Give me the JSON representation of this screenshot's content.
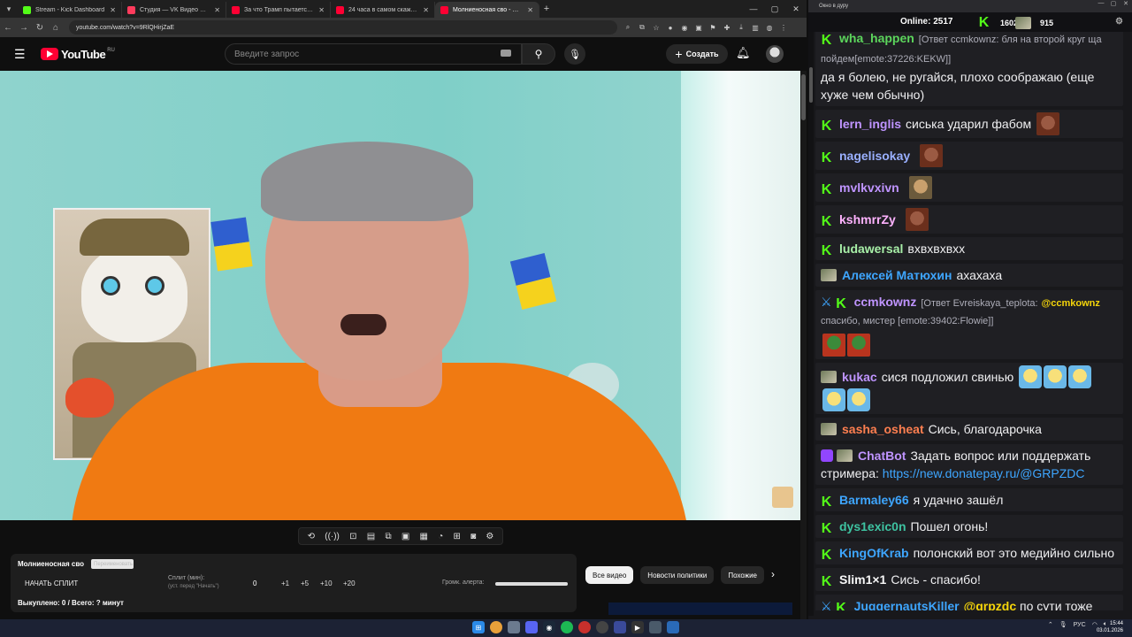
{
  "browser": {
    "tabs": [
      {
        "title": "Stream - Kick Dashboard",
        "favicon_color": "#53fc18",
        "active": false
      },
      {
        "title": "Студия — VK Видео Live",
        "favicon_color": "#ff3b5c",
        "active": false
      },
      {
        "title": "За что Трамп пытается убить",
        "favicon_color": "#ff0033",
        "active": false
      },
      {
        "title": "24 часа в самом скажевшем",
        "favicon_color": "#ff0033",
        "active": false
      },
      {
        "title": "Молниеносная сво - YouTube",
        "favicon_color": "#ff0033",
        "active": true
      }
    ],
    "url": "youtube.com/watch?v=9RlQHirjZaE"
  },
  "youtube": {
    "logo_text": "YouTube",
    "country": "RU",
    "search_placeholder": "Введите запрос",
    "create_label": "Создать"
  },
  "player_tools": [
    "⟲",
    "((·))",
    "⊡",
    "▤",
    "⧉",
    "▣",
    "▦",
    "◔",
    "⊞",
    "◙",
    "⚙"
  ],
  "split": {
    "title": "Молниеносная сво",
    "edit_placeholder": "Переименовать",
    "start_label": "НАЧАТЬ СПЛИТ",
    "split_label": "Сплит (мин):",
    "split_sub": "(уст. перед \"Начать\")",
    "zero": "0",
    "increments": [
      "+1",
      "+5",
      "+10",
      "+20"
    ],
    "volume_label": "Громк. алерта:",
    "volume_level": 1.0,
    "bought": "Выкуплено: 0 / Всего: ? минут"
  },
  "chips": [
    {
      "label": "Все видео",
      "active": true
    },
    {
      "label": "Новости политики",
      "active": false
    },
    {
      "label": "Похожие",
      "active": false
    }
  ],
  "chat": {
    "window_title": "Окно в дуру",
    "online_label": "Online: 2517",
    "kick_count": "1602",
    "rumble_count": "915",
    "messages": [
      {
        "user": "wha_happen",
        "color": "#5cd65c",
        "reply": "[Ответ ccmkownz: бля на второй круг ща пойдем[emote:37226:KEKW]]",
        "text": "да я болею, не ругайся, плохо соображаю (еще хуже чем обычно)"
      },
      {
        "user": "lern_inglis",
        "color": "#bf94ff",
        "text": "сиська ударил фабом"
      },
      {
        "user": "nagelisokay",
        "color": "#9ab0ff",
        "text": ""
      },
      {
        "user": "mvlkvxivn",
        "color": "#bf94ff",
        "text": ""
      },
      {
        "user": "kshmrrZy",
        "color": "#ffb3ff",
        "text": ""
      },
      {
        "user": "ludawersal",
        "color": "#a8f0a8",
        "text": "вхвхвхвхх"
      },
      {
        "user": "Алексей Матюхин",
        "color": "#3ea6ff",
        "text": "ахахаха"
      },
      {
        "user": "ccmkownz",
        "color": "#bf94ff",
        "reply": "[Ответ Evreiskaya_teplota:",
        "mention": "@ccmkownz",
        "reply2": "спасибо, мистер [emote:39402:Flowie]]",
        "text": ""
      },
      {
        "user": "kukac",
        "color": "#bf94ff",
        "text": "сися подложил свинью"
      },
      {
        "user": "sasha_osheat",
        "color": "#ff7f50",
        "text": "Сись, благодарочка"
      },
      {
        "user": "ChatBot",
        "color": "#bf94ff",
        "text": "Задать вопрос или поддержать стримера:",
        "link": "https://new.donatepay.ru/@GRPZDC"
      },
      {
        "user": "Barmaley66",
        "color": "#3ea6ff",
        "text": "я удачно зашёл"
      },
      {
        "user": "dys1exic0n",
        "color": "#3ec3a1",
        "text": "Пошел огонь!"
      },
      {
        "user": "KingOfKrab",
        "color": "#3ea6ff",
        "text": "полонский вот это медийно сильно"
      },
      {
        "user": "Slim1×1",
        "color": "#f7f7f7",
        "text": "Сись - спасибо!"
      },
      {
        "user": "JuggernautsKiller",
        "color": "#3ea6ff",
        "mention": "@grpzdc",
        "text": "по сути тоже самое когда сша арестовали кого то в Европе связочного с футболом вроде"
      }
    ]
  },
  "taskbar": {
    "lang": "РУС",
    "time": "15:44",
    "date": "03.01.2026"
  }
}
